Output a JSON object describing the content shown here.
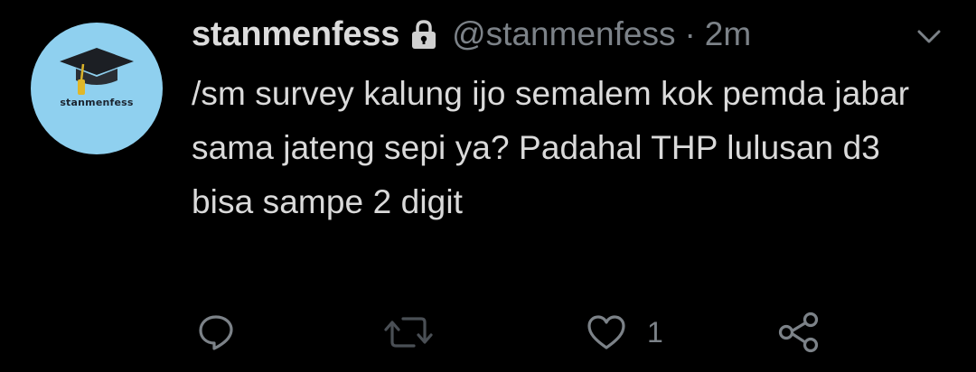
{
  "tweet": {
    "avatar_text": "stanmenfess",
    "display_name": "stanmenfess",
    "handle": "@stanmenfess",
    "separator": "·",
    "time": "2m",
    "text": "/sm survey kalung ijo semalem kok pemda jabar sama jateng sepi ya? Padahal THP lulusan d3 bisa sampe 2 digit",
    "likes": "1"
  },
  "icons": {
    "verified_lock": "lock-icon",
    "menu": "chevron-down-icon",
    "reply": "reply-icon",
    "retweet": "retweet-icon",
    "like": "heart-icon",
    "share": "share-icon"
  },
  "colors": {
    "background": "#000000",
    "text": "#d9d9d9",
    "muted": "#7c8288",
    "avatar_bg": "#8fd0ef"
  }
}
